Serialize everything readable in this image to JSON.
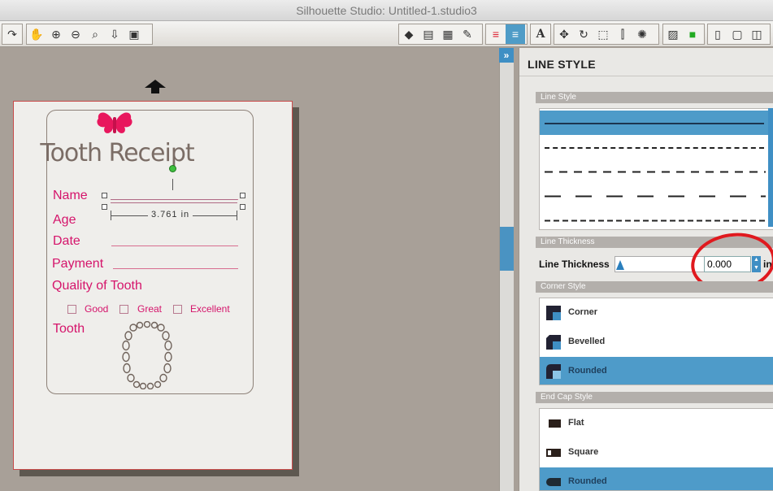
{
  "window": {
    "title": "Silhouette Studio: Untitled-1.studio3"
  },
  "toolbar": {
    "redo_icon": "redo-icon",
    "view_tools": [
      "pan-hand-icon",
      "zoom-in-icon",
      "zoom-out-icon",
      "zoom-select-icon",
      "zoom-drag-icon",
      "fit-page-icon"
    ],
    "panel_tools": [
      "fill-bucket-icon",
      "gradient-icon",
      "pattern-icon",
      "fill-brush-icon",
      "line-color-icon",
      "line-style-icon",
      "text-style-icon",
      "point-edit-icon",
      "replicate-icon",
      "transform-icon",
      "align-icon",
      "offset-icon",
      "trace-icon",
      "cut-settings-icon",
      "page-setup-icon",
      "send-icon",
      "design-store-icon"
    ]
  },
  "canvas": {
    "document": {
      "title": "Tooth Receipt",
      "fields": [
        "Name",
        "Age",
        "Date",
        "Payment",
        "Quality of Tooth"
      ],
      "checkboxes": [
        "Good",
        "Great",
        "Excellent"
      ],
      "tooth_label": "Tooth"
    },
    "dimension_label": "3.761 in"
  },
  "panel": {
    "title": "LINE STYLE",
    "line_style": {
      "header": "Line Style",
      "options": [
        "solid",
        "fine-dash",
        "medium-dash",
        "long-dash",
        "dense-dash"
      ],
      "selected": 0
    },
    "line_thickness": {
      "header": "Line Thickness",
      "label": "Line Thickness",
      "value": "0.000",
      "unit": "in"
    },
    "corner_style": {
      "header": "Corner Style",
      "options": [
        "Corner",
        "Bevelled",
        "Rounded"
      ],
      "selected": 2
    },
    "end_cap_style": {
      "header": "End Cap Style",
      "options": [
        "Flat",
        "Square",
        "Rounded"
      ],
      "selected": 2
    }
  },
  "colors": {
    "accent": "#4e9bc9",
    "annotation": "#e0191e",
    "label_pink": "#d5146b"
  }
}
